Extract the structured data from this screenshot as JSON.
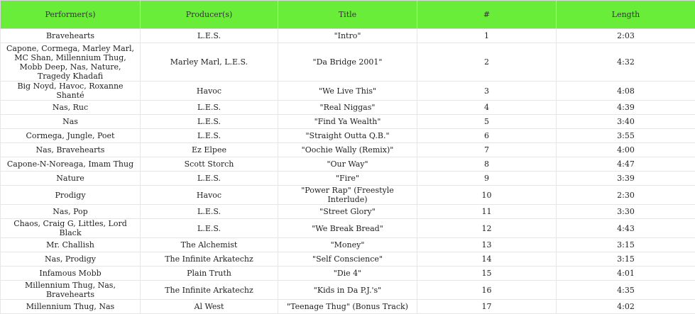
{
  "headers": [
    "Performer(s)",
    "Producer(s)",
    "Title",
    "#",
    "Length"
  ],
  "rows": [
    [
      "Bravehearts",
      "L.E.S.",
      "\"Intro\"",
      "1",
      "2:03"
    ],
    [
      "Capone, Cormega, Marley Marl, MC Shan, Millennium Thug, Mobb Deep, Nas, Nature, Tragedy Khadafi",
      "Marley Marl, L.E.S.",
      "\"Da Bridge 2001\"",
      "2",
      "4:32"
    ],
    [
      "Big Noyd, Havoc, Roxanne Shanté",
      "Havoc",
      "\"We Live This\"",
      "3",
      "4:08"
    ],
    [
      "Nas, Ruc",
      "L.E.S.",
      "\"Real Niggas\"",
      "4",
      "4:39"
    ],
    [
      "Nas",
      "L.E.S.",
      "\"Find Ya Wealth\"",
      "5",
      "3:40"
    ],
    [
      "Cormega, Jungle, Poet",
      "L.E.S.",
      "\"Straight Outta Q.B.\"",
      "6",
      "3:55"
    ],
    [
      "Nas, Bravehearts",
      "Ez Elpee",
      "\"Oochie Wally (Remix)\"",
      "7",
      "4:00"
    ],
    [
      "Capone-N-Noreaga, Imam Thug",
      "Scott Storch",
      "\"Our Way\"",
      "8",
      "4:47"
    ],
    [
      "Nature",
      "L.E.S.",
      "\"Fire\"",
      "9",
      "3:39"
    ],
    [
      "Prodigy",
      "Havoc",
      "\"Power Rap\" (Freestyle Interlude)",
      "10",
      "2:30"
    ],
    [
      "Nas, Pop",
      "L.E.S.",
      "\"Street Glory\"",
      "11",
      "3:30"
    ],
    [
      "Chaos, Craig G, Littles, Lord Black",
      "L.E.S.",
      "\"We Break Bread\"",
      "12",
      "4:43"
    ],
    [
      "Mr. Challish",
      "The Alchemist",
      "\"Money\"",
      "13",
      "3:15"
    ],
    [
      "Nas, Prodigy",
      "The Infinite Arkatechz",
      "\"Self Conscience\"",
      "14",
      "3:15"
    ],
    [
      "Infamous Mobb",
      "Plain Truth",
      "\"Die 4\"",
      "15",
      "4:01"
    ],
    [
      "Millennium Thug, Nas, Bravehearts",
      "The Infinite Arkatechz",
      "\"Kids in Da P.J.'s\"",
      "16",
      "4:35"
    ],
    [
      "Millennium Thug, Nas",
      "Al West",
      "\"Teenage Thug\" (Bonus Track)",
      "17",
      "4:02"
    ]
  ]
}
